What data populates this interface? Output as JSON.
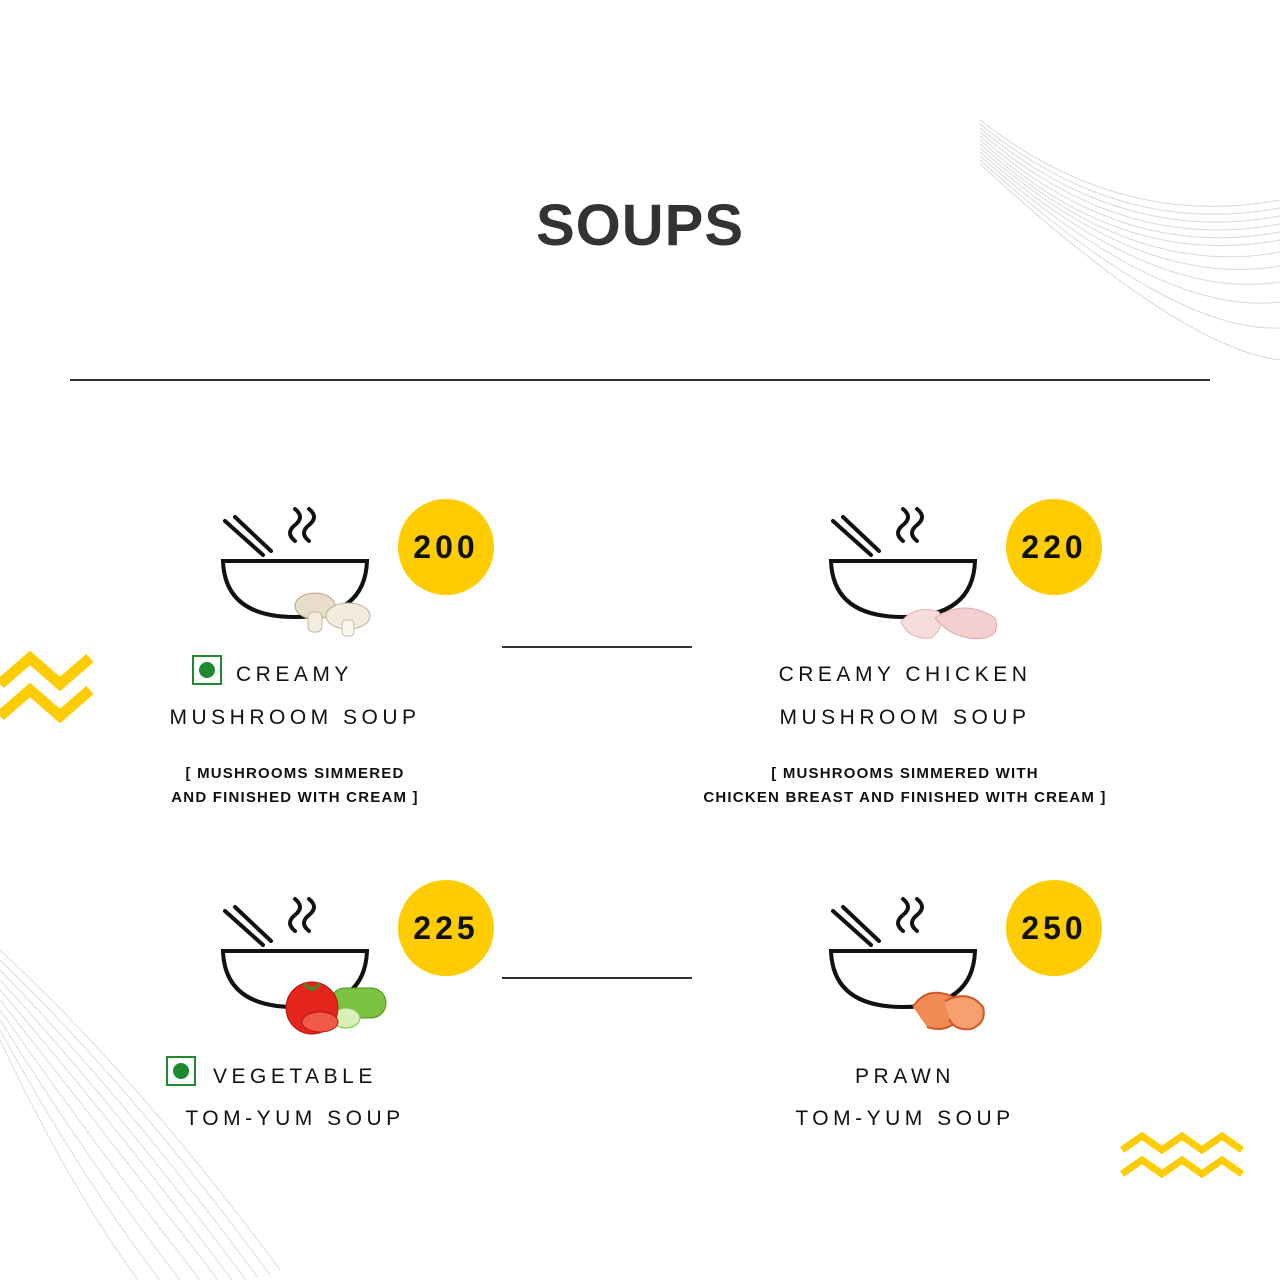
{
  "page": {
    "title": "SOUPS"
  },
  "colors": {
    "accent": "#FFCC00",
    "veg": "#1e8a2e",
    "title": "#333333"
  },
  "items": [
    {
      "price": "200",
      "veg": true,
      "name_line1": "CREAMY",
      "name_line2": "MUSHROOM SOUP",
      "desc_line1": "[ MUSHROOMS SIMMERED",
      "desc_line2": "AND FINISHED WITH CREAM ]",
      "ingredient_icon": "mushroom-icon"
    },
    {
      "price": "220",
      "veg": false,
      "name_line1": "CREAMY CHICKEN",
      "name_line2": "MUSHROOM SOUP",
      "desc_line1": "[ MUSHROOMS SIMMERED WITH",
      "desc_line2": "CHICKEN BREAST AND FINISHED WITH CREAM ]",
      "ingredient_icon": "chicken-icon"
    },
    {
      "price": "225",
      "veg": true,
      "name_line1": "VEGETABLE",
      "name_line2": "TOM-YUM SOUP",
      "ingredient_icon": "tomato-cucumber-icon"
    },
    {
      "price": "250",
      "veg": false,
      "name_line1": "PRAWN",
      "name_line2": "TOM-YUM SOUP",
      "ingredient_icon": "prawn-icon"
    }
  ]
}
